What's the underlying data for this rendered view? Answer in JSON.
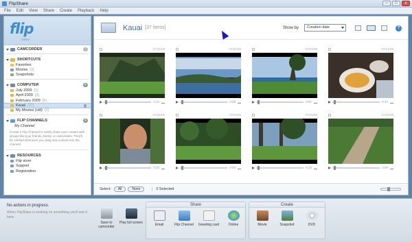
{
  "window": {
    "title": "FlipShare"
  },
  "window_buttons": {
    "minimize": "–",
    "maximize": "□",
    "close": "x"
  },
  "menu": [
    "File",
    "Edit",
    "View",
    "Share",
    "Create",
    "Playback",
    "Help"
  ],
  "logo": {
    "text": "flip",
    "sub": "VIDEO"
  },
  "sidebar": {
    "camcorder": {
      "label": "CAMCORDER"
    },
    "shortcuts": {
      "label": "SHORTCUTS",
      "items": [
        {
          "label": "Favorites",
          "count": ""
        },
        {
          "label": "Movies",
          "count": "[3]"
        },
        {
          "label": "Snapshots",
          "count": ""
        }
      ]
    },
    "computer": {
      "label": "COMPUTER",
      "items": [
        {
          "label": "July 2009",
          "count": "[1]",
          "selected": false
        },
        {
          "label": "April 2009",
          "count": "[3]",
          "selected": false
        },
        {
          "label": "February 2009",
          "count": "[6]",
          "selected": false
        },
        {
          "label": "Kauai",
          "count": "[37]",
          "selected": true
        },
        {
          "label": "My Movies (old)",
          "count": "[3]",
          "selected": false
        }
      ]
    },
    "flip_channels": {
      "label": "FLIP CHANNELS",
      "channel": "My Channel",
      "description": "Create a Flip Channel to easily share your content with groups like your friends, family, or classmates. They'll be notified whenever you drag new content into the channel."
    },
    "resources": {
      "label": "RESOURCES",
      "items": [
        {
          "label": "Flip store"
        },
        {
          "label": "Support"
        },
        {
          "label": "Registration"
        }
      ]
    }
  },
  "main": {
    "folder_title": "Kauai",
    "folder_count": "[37 items]",
    "show_by_label": "Show by",
    "sort_value": "Creation date",
    "help": "?",
    "tiles": [
      {
        "date": "07/21/09",
        "duration": "0:12"
      },
      {
        "date": "07/21/09",
        "duration": "0:08"
      },
      {
        "date": "07/21/09",
        "duration": "0:07"
      },
      {
        "date": "07/21/09",
        "duration": "0:10"
      },
      {
        "date": "07/21/09",
        "duration": "0:23"
      },
      {
        "date": "07/21/09",
        "duration": "0:08"
      },
      {
        "date": "07/21/09",
        "duration": "0:10"
      },
      {
        "date": "07/21/09",
        "duration": "0:09"
      }
    ],
    "footer": {
      "select_label": "Select:",
      "all": "All",
      "none": "None",
      "selected": "0 Selected"
    }
  },
  "bottom": {
    "status": "No actions in progress.",
    "status_sub": "When FlipShare is working on something you'll see it here.",
    "tools_left": [
      {
        "label": "Save to camcorder",
        "icon": "camcorder-icon"
      },
      {
        "label": "Play full screen",
        "icon": "fullscreen-icon"
      }
    ],
    "share_title": "Share",
    "share": [
      {
        "label": "Email",
        "icon": "email-icon"
      },
      {
        "label": "Flip Channel",
        "icon": "flip-channel-icon"
      },
      {
        "label": "Greeting card",
        "icon": "greeting-card-icon"
      },
      {
        "label": "Online",
        "icon": "online-globe-icon"
      }
    ],
    "create_title": "Create",
    "create": [
      {
        "label": "Movie",
        "icon": "movie-icon"
      },
      {
        "label": "Snapshot",
        "icon": "snapshot-icon"
      },
      {
        "label": "DVD",
        "icon": "dvd-icon"
      }
    ]
  },
  "colors": {
    "accent": "#3f8dcc",
    "frame": "#5f84a6",
    "selected_row": "#cfe1f3"
  }
}
